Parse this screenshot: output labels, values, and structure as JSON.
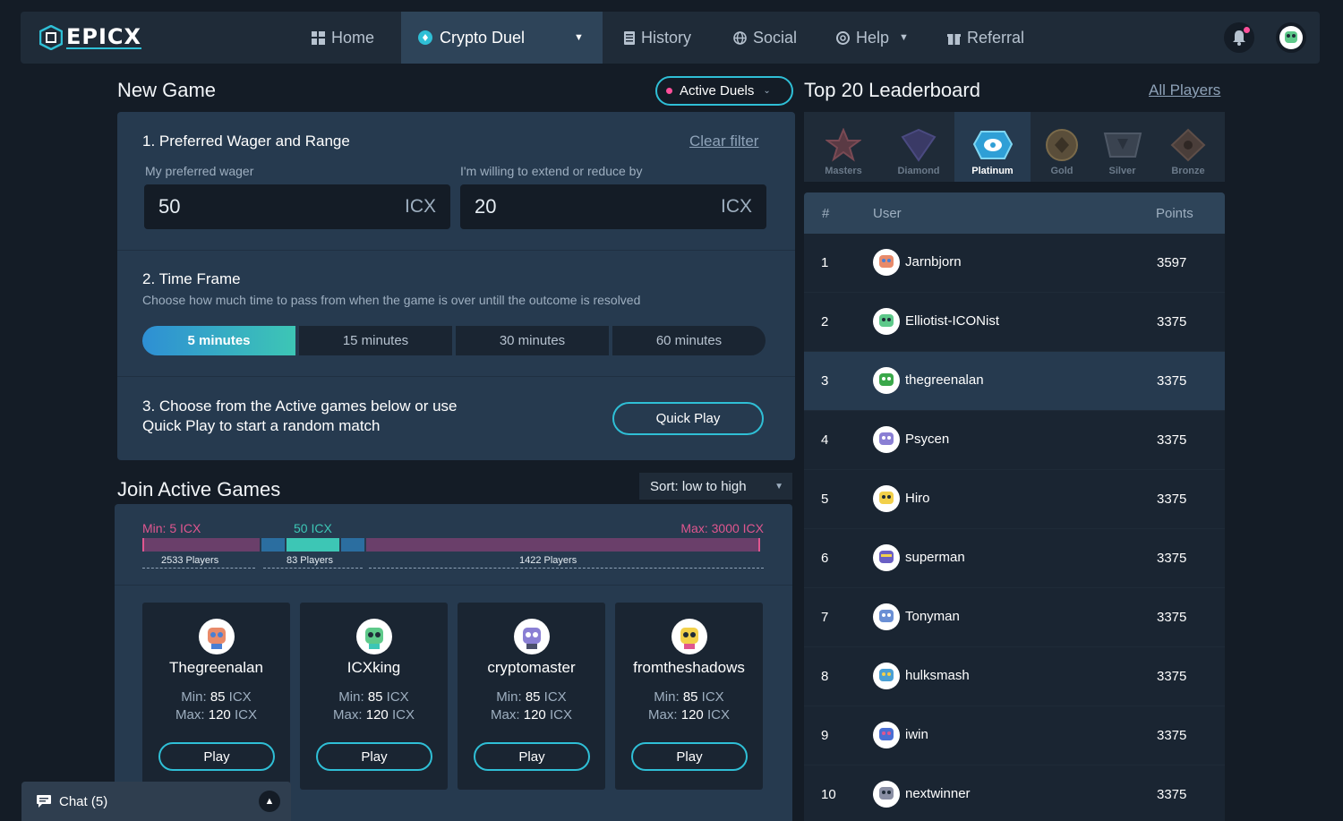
{
  "nav": {
    "logo": "EPICX",
    "items": [
      {
        "label": "Home",
        "icon": "grid-icon"
      },
      {
        "label": "Crypto Duel",
        "icon": "icx-coin-icon"
      },
      {
        "label": "History",
        "icon": "document-icon"
      },
      {
        "label": "Social",
        "icon": "globe-icon"
      },
      {
        "label": "Help",
        "icon": "lifebuoy-icon"
      },
      {
        "label": "Referral",
        "icon": "gift-icon"
      }
    ]
  },
  "new_game": {
    "title": "New Game",
    "active_duels": "Active Duels",
    "wager_title": "1. Preferred Wager and Range",
    "clear_filter": "Clear filter",
    "wager_label": "My preferred wager",
    "wager_value": "50",
    "wager_unit": "ICX",
    "range_label": "I'm willing to extend or reduce by",
    "range_value": "20",
    "range_unit": "ICX",
    "time_title": "2. Time Frame",
    "time_sub": "Choose how much time to pass from when the game is over untill the outcome is resolved",
    "time_options": [
      "5 minutes",
      "15 minutes",
      "30 minutes",
      "60 minutes"
    ],
    "choose_line1": "3. Choose from the Active games below or use",
    "choose_line2": "Quick Play to start a random match",
    "quick_play": "Quick Play"
  },
  "join": {
    "title": "Join Active Games",
    "sort": "Sort: low to high",
    "min_label": "Min: 5 ICX",
    "mid_label": "50 ICX",
    "max_label": "Max: 3000 ICX",
    "count_left": "2533 Players",
    "count_mid": "83 Players",
    "count_right": "1422 Players",
    "min_word": "Min:",
    "max_word": "Max:",
    "unit": "ICX",
    "play": "Play",
    "games": [
      {
        "name": "Thegreenalan",
        "min": "85",
        "max": "120"
      },
      {
        "name": "ICXking",
        "min": "85",
        "max": "120"
      },
      {
        "name": "cryptomaster",
        "min": "85",
        "max": "120"
      },
      {
        "name": "fromtheshadows",
        "min": "85",
        "max": "120"
      }
    ]
  },
  "chat": {
    "label": "Chat (5)"
  },
  "leaderboard": {
    "title": "Top 20 Leaderboard",
    "all_players": "All Players",
    "tiers": [
      "Masters",
      "Diamond",
      "Platinum",
      "Gold",
      "Silver",
      "Bronze"
    ],
    "col_rank": "#",
    "col_user": "User",
    "col_points": "Points",
    "rows": [
      {
        "rank": "1",
        "user": "Jarnbjorn",
        "points": "3597"
      },
      {
        "rank": "2",
        "user": "Elliotist-ICONist",
        "points": "3375"
      },
      {
        "rank": "3",
        "user": "thegreenalan",
        "points": "3375"
      },
      {
        "rank": "4",
        "user": "Psycen",
        "points": "3375"
      },
      {
        "rank": "5",
        "user": "Hiro",
        "points": "3375"
      },
      {
        "rank": "6",
        "user": "superman",
        "points": "3375"
      },
      {
        "rank": "7",
        "user": "Tonyman",
        "points": "3375"
      },
      {
        "rank": "8",
        "user": "hulksmash",
        "points": "3375"
      },
      {
        "rank": "9",
        "user": "iwin",
        "points": "3375"
      },
      {
        "rank": "10",
        "user": "nextwinner",
        "points": "3375"
      }
    ]
  },
  "colors": {
    "accent": "#2fbfd6",
    "pink": "#e0568f",
    "teal": "#3dc6b5",
    "panel": "#263a4f",
    "bg": "#141c26"
  }
}
